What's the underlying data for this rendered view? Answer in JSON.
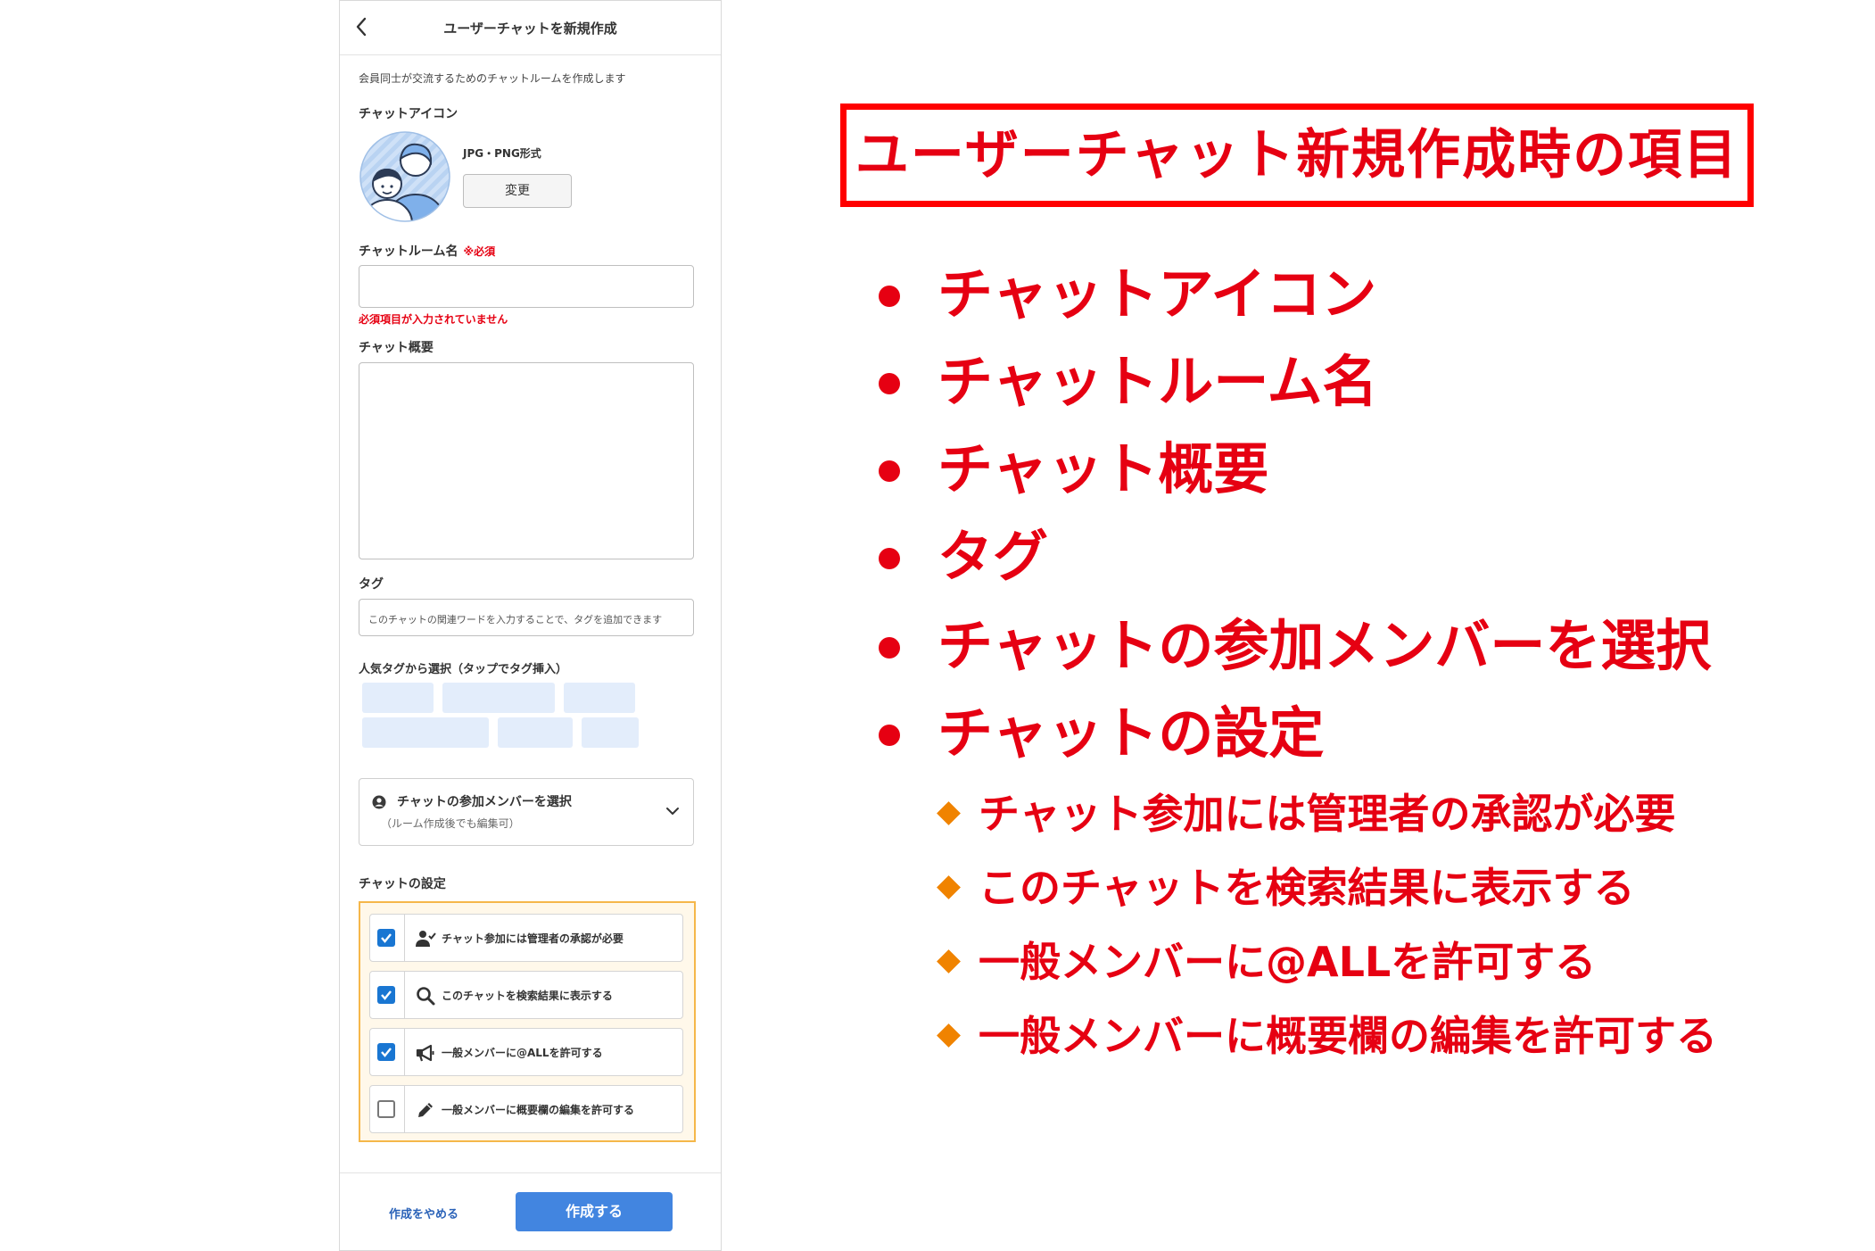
{
  "phone": {
    "header_title": "ユーザーチャットを新規作成",
    "intro": "会員同士が交流するためのチャットルームを作成します",
    "icon_section": {
      "label": "チャットアイコン",
      "format": "JPG・PNG形式",
      "change_button": "変更"
    },
    "room_name": {
      "label": "チャットルーム名",
      "required": "※必須",
      "value": "",
      "error": "必須項目が入力されていません"
    },
    "summary": {
      "label": "チャット概要",
      "value": ""
    },
    "tag": {
      "label": "タグ",
      "placeholder": "このチャットの関連ワードを入力することで、タグを追加できます"
    },
    "popular_tags": {
      "label": "人気タグから選択（タップでタグ挿入）"
    },
    "members": {
      "title": "チャットの参加メンバーを選択",
      "subtitle": "（ルーム作成後でも編集可）"
    },
    "settings": {
      "label": "チャットの設定",
      "items": [
        {
          "label": "チャット参加には管理者の承認が必要",
          "checked": true,
          "icon": "user-check-icon"
        },
        {
          "label": "このチャットを検索結果に表示する",
          "checked": true,
          "icon": "search-icon"
        },
        {
          "label": "一般メンバーに@ALLを許可する",
          "checked": true,
          "icon": "megaphone-icon"
        },
        {
          "label": "一般メンバーに概要欄の編集を許可する",
          "checked": false,
          "icon": "pencil-icon"
        }
      ]
    },
    "footer": {
      "cancel": "作成をやめる",
      "submit": "作成する"
    }
  },
  "annotation": {
    "title": "ユーザーチャット新規作成時の項目",
    "bullets": [
      "チャットアイコン",
      "チャットルーム名",
      "チャット概要",
      "タグ",
      "チャットの参加メンバーを選択",
      "チャットの設定"
    ],
    "sub_items": [
      "チャット参加には管理者の承認が必要",
      "このチャットを検索結果に表示する",
      "一般メンバーに@ALLを許可する",
      "一般メンバーに概要欄の編集を許可する"
    ]
  },
  "colors": {
    "accent_red": "#e60012",
    "primary_blue": "#4285e0",
    "checkbox_blue": "#1976d2",
    "settings_border": "#f5b74a",
    "diamond_orange": "#f08300",
    "chip_blue": "#e3edfb"
  }
}
